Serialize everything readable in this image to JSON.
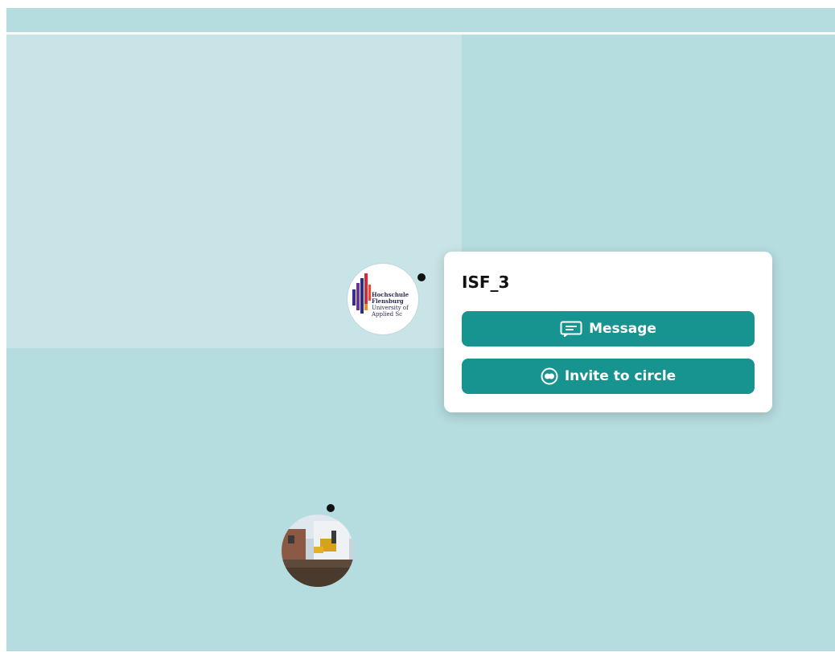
{
  "popup": {
    "title": "ISF_3",
    "message_label": "Message",
    "invite_label": "Invite to circle"
  },
  "logo": {
    "line1": "Hochschule",
    "line2": "Flensburg",
    "line3": "University of",
    "line4": "Applied Sc"
  },
  "colors": {
    "background": "#b5dcdf",
    "highlight": "#c9e4e6",
    "accent": "#189490"
  }
}
